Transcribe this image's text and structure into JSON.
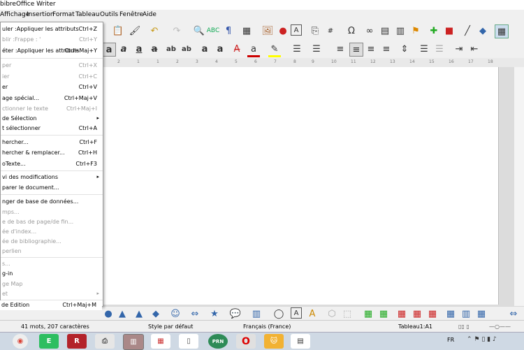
{
  "window": {
    "title": "bibreOffice Writer"
  },
  "menubar": {
    "items": [
      {
        "label": "Affichage"
      },
      {
        "label": "Insertion"
      },
      {
        "label": "Format"
      },
      {
        "label": "Tableau"
      },
      {
        "label": "Outils"
      },
      {
        "label": "Fenêtre"
      },
      {
        "label": "Aide"
      }
    ]
  },
  "dropdown": {
    "items": [
      {
        "label": "uler :Appliquer les attributs",
        "shortcut": "Ctrl+Z",
        "disabled": false
      },
      {
        "label": "blir :Frappe : '",
        "shortcut": "Ctrl+Y",
        "disabled": true
      },
      {
        "label": "éter :Appliquer les attributs",
        "shortcut": "Ctrl+Maj+Y",
        "disabled": false
      },
      {
        "label": "per",
        "shortcut": "Ctrl+X",
        "disabled": true
      },
      {
        "label": "ier",
        "shortcut": "Ctrl+C",
        "disabled": true
      },
      {
        "label": "er",
        "shortcut": "Ctrl+V",
        "disabled": false
      },
      {
        "label": "age spécial...",
        "shortcut": "Ctrl+Maj+V",
        "disabled": false
      },
      {
        "label": "ctionner le texte",
        "shortcut": "Ctrl+Maj+I",
        "disabled": true
      },
      {
        "label": "de Sélection",
        "shortcut": "",
        "submenu": true,
        "disabled": false
      },
      {
        "label": "t sélectionner",
        "shortcut": "Ctrl+A",
        "disabled": false
      },
      {
        "label": "hercher...",
        "shortcut": "Ctrl+F",
        "disabled": false
      },
      {
        "label": "hercher & remplacer...",
        "shortcut": "Ctrl+H",
        "disabled": false
      },
      {
        "label": "oTexte...",
        "shortcut": "Ctrl+F3",
        "disabled": false
      },
      {
        "label": "vi des modifications",
        "shortcut": "",
        "submenu": true,
        "disabled": false
      },
      {
        "label": "parer le document...",
        "shortcut": "",
        "disabled": false
      },
      {
        "label": "nger de base de données...",
        "shortcut": "",
        "disabled": false
      },
      {
        "label": "mps...",
        "shortcut": "",
        "disabled": true
      },
      {
        "label": "e de bas de page/de fin...",
        "shortcut": "",
        "disabled": true
      },
      {
        "label": "ée d'index...",
        "shortcut": "",
        "disabled": true
      },
      {
        "label": "ée de bibliographie...",
        "shortcut": "",
        "disabled": true
      },
      {
        "label": "perlien",
        "shortcut": "",
        "disabled": true
      },
      {
        "label": "s...",
        "shortcut": "",
        "disabled": true
      },
      {
        "label": "g-in",
        "shortcut": "",
        "disabled": false
      },
      {
        "label": "ge Map",
        "shortcut": "",
        "disabled": true
      },
      {
        "label": "et",
        "shortcut": "",
        "submenu": true,
        "disabled": true
      },
      {
        "label": "de Edition",
        "shortcut": "Ctrl+Maj+M",
        "disabled": false
      }
    ]
  },
  "ruler": {
    "ticks": [
      "2",
      "1",
      "1",
      "2",
      "3",
      "4",
      "5",
      "6",
      "7",
      "8",
      "9",
      "10",
      "11",
      "12",
      "13",
      "14",
      "15",
      "16",
      "17",
      "18"
    ]
  },
  "statusbar": {
    "words": "41 mots, 207 caractères",
    "style": "Style par défaut",
    "language": "Français (France)",
    "table": "Tableau1:A1"
  },
  "taskbar": {
    "lang": "FR",
    "apps": [
      "chrome",
      "evernote",
      "R",
      "scanner",
      "books",
      "grid",
      "document",
      "PRN",
      "opera",
      "cat",
      "notes"
    ]
  }
}
